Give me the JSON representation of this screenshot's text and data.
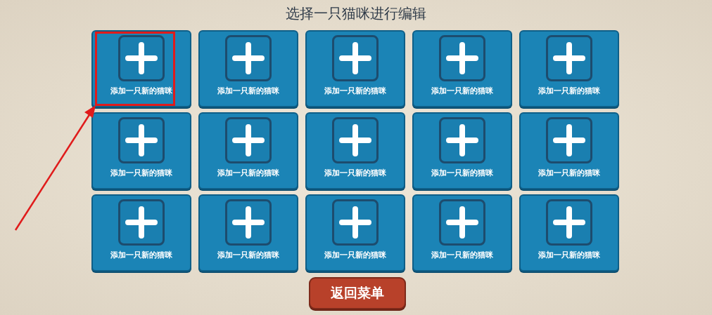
{
  "title": "选择一只猫咪进行编辑",
  "cards": [
    {
      "label": "添加一只新的猫咪",
      "highlighted": true
    },
    {
      "label": "添加一只新的猫咪",
      "highlighted": false
    },
    {
      "label": "添加一只新的猫咪",
      "highlighted": false
    },
    {
      "label": "添加一只新的猫咪",
      "highlighted": false
    },
    {
      "label": "添加一只新的猫咪",
      "highlighted": false
    },
    {
      "label": "添加一只新的猫咪",
      "highlighted": false
    },
    {
      "label": "添加一只新的猫咪",
      "highlighted": false
    },
    {
      "label": "添加一只新的猫咪",
      "highlighted": false
    },
    {
      "label": "添加一只新的猫咪",
      "highlighted": false
    },
    {
      "label": "添加一只新的猫咪",
      "highlighted": false
    },
    {
      "label": "添加一只新的猫咪",
      "highlighted": false
    },
    {
      "label": "添加一只新的猫咪",
      "highlighted": false
    },
    {
      "label": "添加一只新的猫咪",
      "highlighted": false
    },
    {
      "label": "添加一只新的猫咪",
      "highlighted": false
    },
    {
      "label": "添加一只新的猫咪",
      "highlighted": false
    }
  ],
  "back_button": {
    "label": "返回菜单"
  }
}
